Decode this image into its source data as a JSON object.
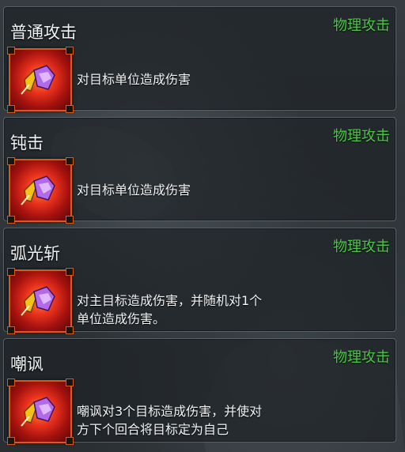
{
  "colors": {
    "type_text": "#4cc646",
    "icon_frame": "#d65a1c",
    "card_border": "#5b6166"
  },
  "skills": [
    {
      "name": "普通攻击",
      "type": "物理攻击",
      "icon": "sword-strike-icon",
      "desc_lines": [
        "对目标单位造成伤害"
      ]
    },
    {
      "name": "钝击",
      "type": "物理攻击",
      "icon": "sword-strike-icon",
      "desc_lines": [
        "对目标单位造成伤害"
      ]
    },
    {
      "name": "弧光斩",
      "type": "物理攻击",
      "icon": "sword-strike-icon",
      "desc_lines": [
        "对主目标造成伤害，并随机对1个",
        "单位造成伤害。"
      ]
    },
    {
      "name": "嘲讽",
      "type": "物理攻击",
      "icon": "sword-strike-icon",
      "desc_lines": [
        "嘲讽对3个目标造成伤害，并使对",
        "方下个回合将目标定为自己"
      ]
    }
  ]
}
